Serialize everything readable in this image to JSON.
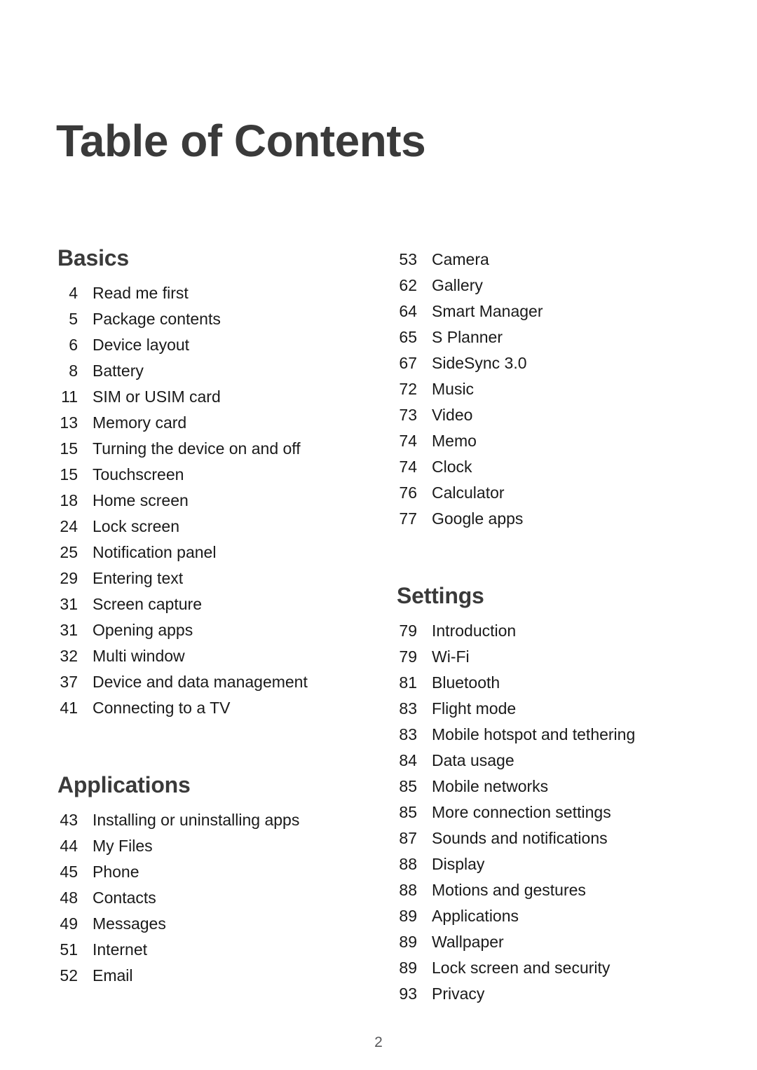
{
  "document": {
    "title": "Table of Contents",
    "page_number": "2"
  },
  "columns": {
    "left": [
      {
        "heading": "Basics",
        "entries": [
          {
            "page": "4",
            "title": "Read me first"
          },
          {
            "page": "5",
            "title": "Package contents"
          },
          {
            "page": "6",
            "title": "Device layout"
          },
          {
            "page": "8",
            "title": "Battery"
          },
          {
            "page": "11",
            "title": "SIM or USIM card"
          },
          {
            "page": "13",
            "title": "Memory card"
          },
          {
            "page": "15",
            "title": "Turning the device on and off"
          },
          {
            "page": "15",
            "title": "Touchscreen"
          },
          {
            "page": "18",
            "title": "Home screen"
          },
          {
            "page": "24",
            "title": "Lock screen"
          },
          {
            "page": "25",
            "title": "Notification panel"
          },
          {
            "page": "29",
            "title": "Entering text"
          },
          {
            "page": "31",
            "title": "Screen capture"
          },
          {
            "page": "31",
            "title": "Opening apps"
          },
          {
            "page": "32",
            "title": "Multi window"
          },
          {
            "page": "37",
            "title": "Device and data management"
          },
          {
            "page": "41",
            "title": "Connecting to a TV"
          }
        ]
      },
      {
        "heading": "Applications",
        "entries": [
          {
            "page": "43",
            "title": "Installing or uninstalling apps"
          },
          {
            "page": "44",
            "title": "My Files"
          },
          {
            "page": "45",
            "title": "Phone"
          },
          {
            "page": "48",
            "title": "Contacts"
          },
          {
            "page": "49",
            "title": "Messages"
          },
          {
            "page": "51",
            "title": "Internet"
          },
          {
            "page": "52",
            "title": "Email"
          }
        ]
      }
    ],
    "right": [
      {
        "heading": "",
        "entries": [
          {
            "page": "53",
            "title": "Camera"
          },
          {
            "page": "62",
            "title": "Gallery"
          },
          {
            "page": "64",
            "title": "Smart Manager"
          },
          {
            "page": "65",
            "title": "S Planner"
          },
          {
            "page": "67",
            "title": "SideSync 3.0"
          },
          {
            "page": "72",
            "title": "Music"
          },
          {
            "page": "73",
            "title": "Video"
          },
          {
            "page": "74",
            "title": "Memo"
          },
          {
            "page": "74",
            "title": "Clock"
          },
          {
            "page": "76",
            "title": "Calculator"
          },
          {
            "page": "77",
            "title": "Google apps"
          }
        ]
      },
      {
        "heading": "Settings",
        "entries": [
          {
            "page": "79",
            "title": "Introduction"
          },
          {
            "page": "79",
            "title": "Wi-Fi"
          },
          {
            "page": "81",
            "title": "Bluetooth"
          },
          {
            "page": "83",
            "title": "Flight mode"
          },
          {
            "page": "83",
            "title": "Mobile hotspot and tethering"
          },
          {
            "page": "84",
            "title": "Data usage"
          },
          {
            "page": "85",
            "title": "Mobile networks"
          },
          {
            "page": "85",
            "title": "More connection settings"
          },
          {
            "page": "87",
            "title": "Sounds and notifications"
          },
          {
            "page": "88",
            "title": "Display"
          },
          {
            "page": "88",
            "title": "Motions and gestures"
          },
          {
            "page": "89",
            "title": "Applications"
          },
          {
            "page": "89",
            "title": "Wallpaper"
          },
          {
            "page": "89",
            "title": "Lock screen and security"
          },
          {
            "page": "93",
            "title": "Privacy"
          }
        ]
      }
    ]
  }
}
